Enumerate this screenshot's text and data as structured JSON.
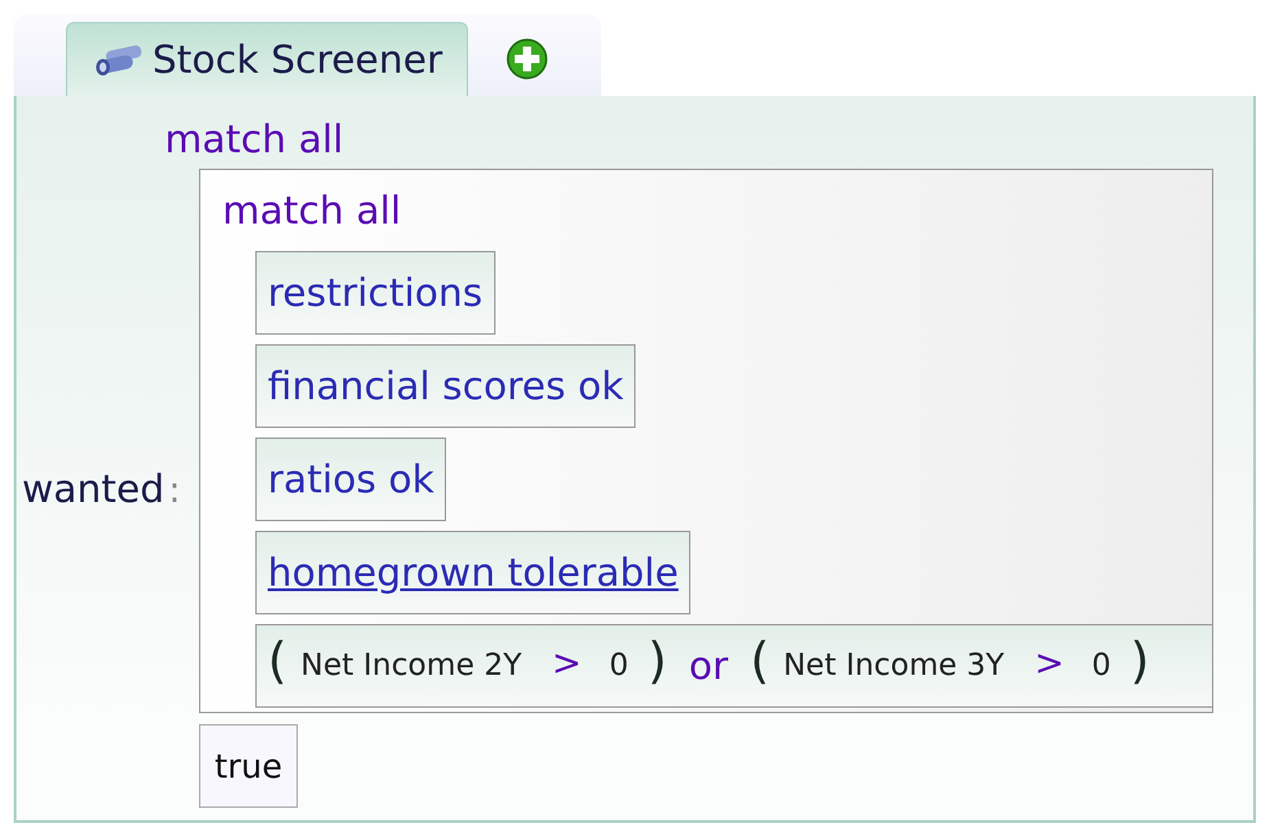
{
  "tabs": [
    {
      "label": "Stock Screener",
      "selected": true
    }
  ],
  "rule": {
    "outer_operator": "match all",
    "label": "wanted",
    "separator": ":",
    "inner_operator": "match all",
    "conditions": [
      {
        "kind": "name",
        "text": "restrictions",
        "link": false
      },
      {
        "kind": "name",
        "text": "financial scores ok",
        "link": false
      },
      {
        "kind": "name",
        "text": "ratios ok",
        "link": false
      },
      {
        "kind": "name",
        "text": "homegrown tolerable",
        "link": true
      },
      {
        "kind": "expression",
        "joiner": "or",
        "groups": [
          {
            "open": "(",
            "field": "Net Income 2Y",
            "operator": ">",
            "value": "0",
            "close": ")"
          },
          {
            "open": "(",
            "field": "Net Income 3Y",
            "operator": ">",
            "value": "0",
            "close": ")"
          }
        ]
      }
    ],
    "result": "true"
  }
}
